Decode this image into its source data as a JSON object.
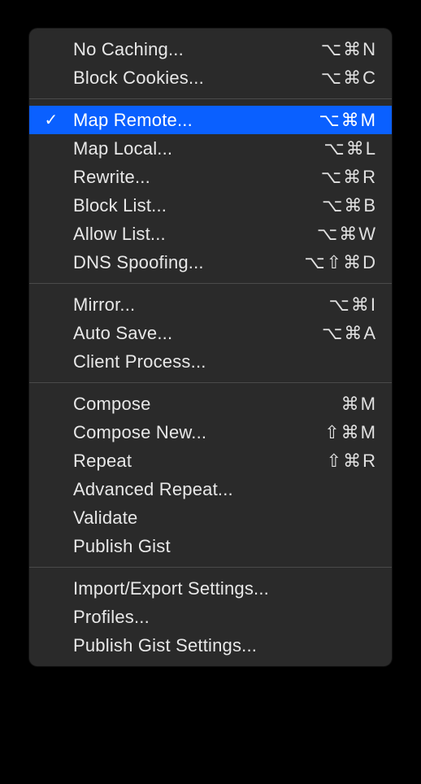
{
  "menu": {
    "groups": [
      {
        "items": [
          {
            "label": "No Caching...",
            "shortcut": "⌥⌘N",
            "checked": false,
            "selected": false
          },
          {
            "label": "Block Cookies...",
            "shortcut": "⌥⌘C",
            "checked": false,
            "selected": false
          }
        ]
      },
      {
        "items": [
          {
            "label": "Map Remote...",
            "shortcut": "⌥⌘M",
            "checked": true,
            "selected": true
          },
          {
            "label": "Map Local...",
            "shortcut": "⌥⌘L",
            "checked": false,
            "selected": false
          },
          {
            "label": "Rewrite...",
            "shortcut": "⌥⌘R",
            "checked": false,
            "selected": false
          },
          {
            "label": "Block List...",
            "shortcut": "⌥⌘B",
            "checked": false,
            "selected": false
          },
          {
            "label": "Allow List...",
            "shortcut": "⌥⌘W",
            "checked": false,
            "selected": false
          },
          {
            "label": "DNS Spoofing...",
            "shortcut": "⌥⇧⌘D",
            "checked": false,
            "selected": false
          }
        ]
      },
      {
        "items": [
          {
            "label": "Mirror...",
            "shortcut": "⌥⌘I",
            "checked": false,
            "selected": false
          },
          {
            "label": "Auto Save...",
            "shortcut": "⌥⌘A",
            "checked": false,
            "selected": false
          },
          {
            "label": "Client Process...",
            "shortcut": "",
            "checked": false,
            "selected": false
          }
        ]
      },
      {
        "items": [
          {
            "label": "Compose",
            "shortcut": "⌘M",
            "checked": false,
            "selected": false
          },
          {
            "label": "Compose New...",
            "shortcut": "⇧⌘M",
            "checked": false,
            "selected": false
          },
          {
            "label": "Repeat",
            "shortcut": "⇧⌘R",
            "checked": false,
            "selected": false
          },
          {
            "label": "Advanced Repeat...",
            "shortcut": "",
            "checked": false,
            "selected": false
          },
          {
            "label": "Validate",
            "shortcut": "",
            "checked": false,
            "selected": false
          },
          {
            "label": "Publish Gist",
            "shortcut": "",
            "checked": false,
            "selected": false
          }
        ]
      },
      {
        "items": [
          {
            "label": "Import/Export Settings...",
            "shortcut": "",
            "checked": false,
            "selected": false
          },
          {
            "label": "Profiles...",
            "shortcut": "",
            "checked": false,
            "selected": false
          },
          {
            "label": "Publish Gist Settings...",
            "shortcut": "",
            "checked": false,
            "selected": false
          }
        ]
      }
    ]
  },
  "glyphs": {
    "check": "✓"
  }
}
